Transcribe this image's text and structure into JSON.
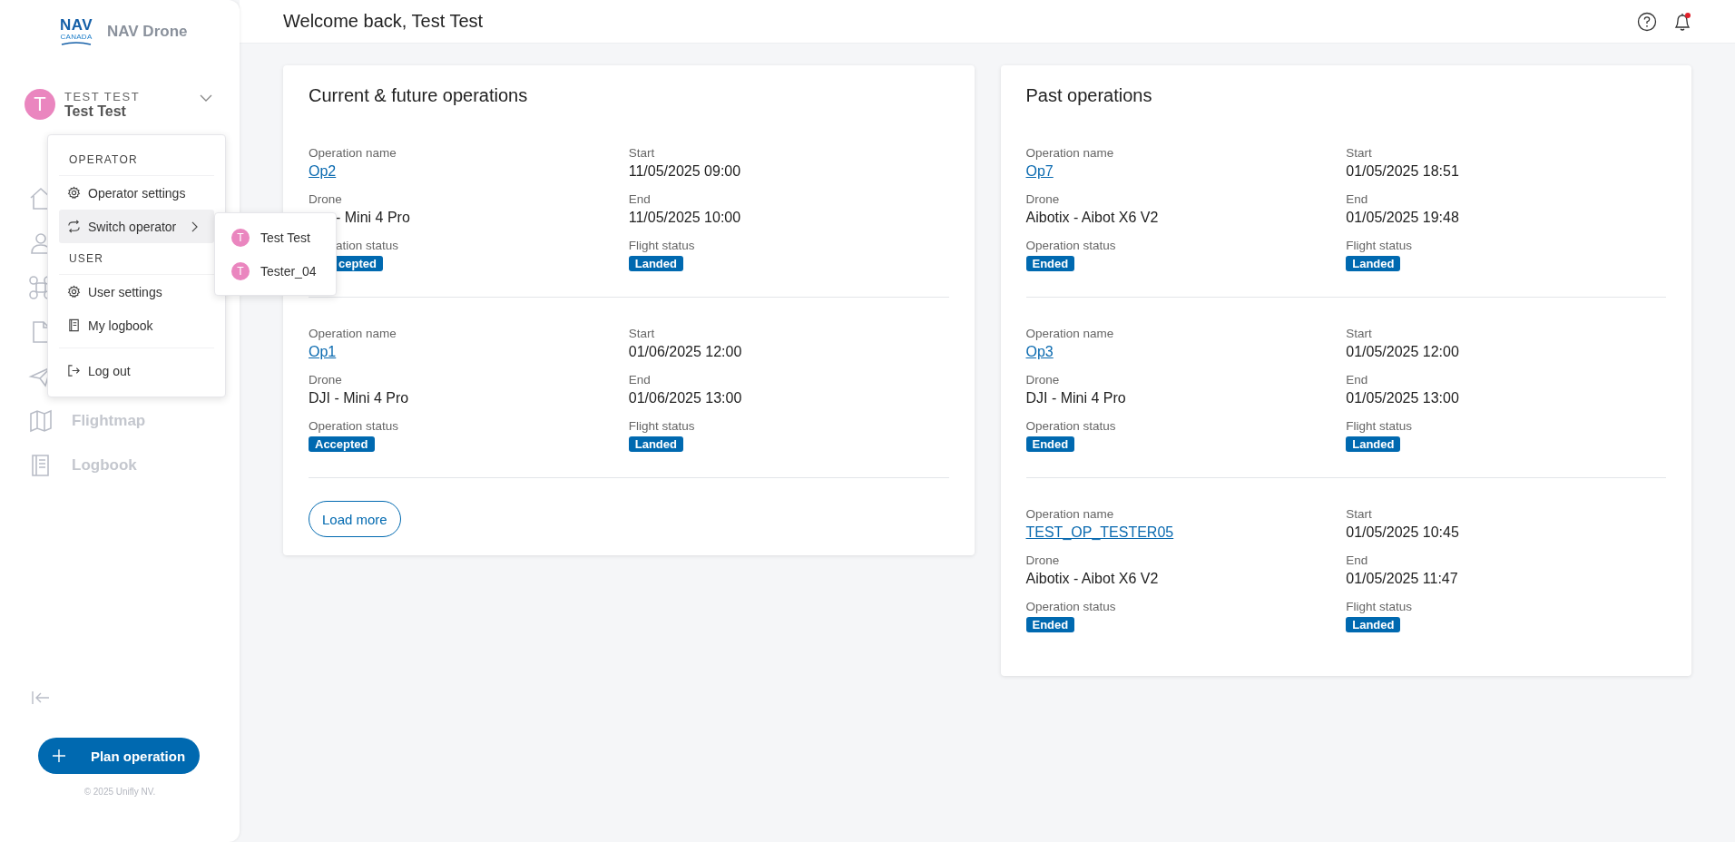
{
  "brand": {
    "logo_top": "NAV",
    "logo_bottom": "CANADA",
    "name": "NAV Drone"
  },
  "user": {
    "org": "TEST TEST",
    "name": "Test Test",
    "avatar": "T",
    "expanded": true
  },
  "user_menu": {
    "sections": [
      {
        "title": "OPERATOR",
        "items": [
          {
            "kind": "gear",
            "label": "Operator settings",
            "selected": false,
            "submenu": false
          },
          {
            "kind": "switch",
            "label": "Switch operator",
            "selected": true,
            "submenu": true
          }
        ]
      },
      {
        "title": "USER",
        "items": [
          {
            "kind": "gear",
            "label": "User settings",
            "selected": false,
            "submenu": false
          },
          {
            "kind": "book",
            "label": "My logbook",
            "selected": false,
            "submenu": false
          }
        ]
      },
      {
        "items": [
          {
            "kind": "logout",
            "label": "Log out",
            "selected": false,
            "submenu": false
          }
        ]
      }
    ]
  },
  "operator_submenu": [
    {
      "avatar": "T",
      "label": "Test Test"
    },
    {
      "avatar": "T",
      "label": "Tester_04"
    }
  ],
  "nav_items": [
    {
      "kind": "home"
    },
    {
      "kind": "person"
    },
    {
      "kind": "drone"
    },
    {
      "kind": "document"
    },
    {
      "kind": "plane"
    },
    {
      "kind": "map",
      "label": "Flightmap"
    },
    {
      "kind": "book",
      "label": "Logbook"
    }
  ],
  "plan_button": "Plan operation",
  "copyright": "© 2025 Unifly NV.",
  "header": {
    "title": "Welcome back, Test Test",
    "notifications_unread": true
  },
  "cards": [
    {
      "title": "Current & future operations",
      "load_more": "Load more",
      "operations": [
        {
          "under_menu": true,
          "name_label": "Operation name",
          "name": "Op2",
          "start_label": "Start",
          "start": "11/05/2025 09:00",
          "drone_label": "Drone",
          "drone": "- Mini 4 Pro",
          "end_label": "End",
          "end": "11/05/2025 10:00",
          "status_label": "ation status",
          "status": "cepted",
          "flight_label": "Flight status",
          "flight": "Landed"
        },
        {
          "under_menu": false,
          "name_label": "Operation name",
          "name": "Op1",
          "start_label": "Start",
          "start": "01/06/2025 12:00",
          "drone_label": "Drone",
          "drone": "DJI - Mini 4 Pro",
          "end_label": "End",
          "end": "01/06/2025 13:00",
          "status_label": "Operation status",
          "status": "Accepted",
          "flight_label": "Flight status",
          "flight": "Landed"
        }
      ]
    },
    {
      "title": "Past operations",
      "operations": [
        {
          "under_menu": false,
          "name_label": "Operation name",
          "name": "Op7",
          "start_label": "Start",
          "start": "01/05/2025 18:51",
          "drone_label": "Drone",
          "drone": "Aibotix - Aibot X6 V2",
          "end_label": "End",
          "end": "01/05/2025 19:48",
          "status_label": "Operation status",
          "status": "Ended",
          "flight_label": "Flight status",
          "flight": "Landed"
        },
        {
          "under_menu": false,
          "name_label": "Operation name",
          "name": "Op3",
          "start_label": "Start",
          "start": "01/05/2025 12:00",
          "drone_label": "Drone",
          "drone": "DJI - Mini 4 Pro",
          "end_label": "End",
          "end": "01/05/2025 13:00",
          "status_label": "Operation status",
          "status": "Ended",
          "flight_label": "Flight status",
          "flight": "Landed"
        },
        {
          "under_menu": false,
          "name_label": "Operation name",
          "name": "TEST_OP_TESTER05",
          "start_label": "Start",
          "start": "01/05/2025 10:45",
          "drone_label": "Drone",
          "drone": "Aibotix - Aibot X6 V2",
          "end_label": "End",
          "end": "01/05/2025 11:47",
          "status_label": "Operation status",
          "status": "Ended",
          "flight_label": "Flight status",
          "flight": "Landed"
        }
      ]
    }
  ]
}
